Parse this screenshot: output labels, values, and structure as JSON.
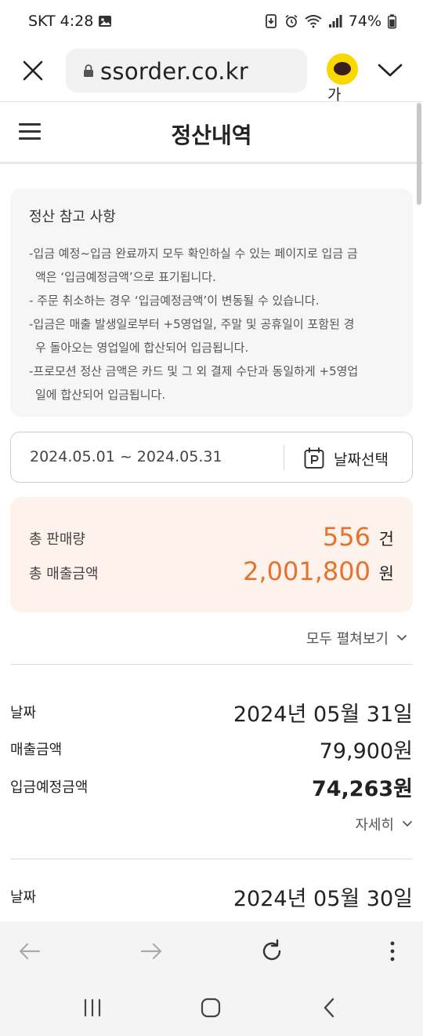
{
  "status_bar": {
    "carrier": "SKT",
    "time": "4:28",
    "battery": "74%"
  },
  "browser": {
    "url": "ssorder.co.kr",
    "text_size_label": "가가"
  },
  "header": {
    "title": "정산내역"
  },
  "notice": {
    "title": "정산 참고 사항",
    "lines": [
      "-입금 예정~입금 완료까지 모두 확인하실 수 있는 페이지로 입금 금",
      "액은 ‘입금예정금액’으로 표기됩니다.",
      "- 주문 취소하는 경우 ‘입금예정금액’이 변동될 수 있습니다.",
      "-입금은 매출 발생일로부터 +5영업일, 주말 및 공휴일이 포함된 경",
      "우 돌아오는 영업일에 합산되어 입금됩니다.",
      "-프로모션 정산 금액은 카드 및 그 외 결제 수단과 동일하게 +5영업",
      "일에 합산되어 입금됩니다."
    ]
  },
  "date_filter": {
    "range": "2024.05.01 ~ 2024.05.31",
    "picker_label": "날짜선택"
  },
  "summary": {
    "total_count_label": "총 판매량",
    "total_count_value": "556",
    "total_count_unit": "건",
    "total_sales_label": "총 매출금액",
    "total_sales_value": "2,001,800",
    "total_sales_unit": "원"
  },
  "expand_all_label": "모두 펼쳐보기",
  "records": [
    {
      "date_label": "날짜",
      "date_value": "2024년 05월 31일",
      "sales_label": "매출금액",
      "sales_value": "79,900원",
      "deposit_label": "입금예정금액",
      "deposit_value": "74,263원",
      "detail_label": "자세히"
    },
    {
      "date_label": "날짜",
      "date_value": "2024년 05월 30일"
    }
  ],
  "colors": {
    "accent": "#e5732d",
    "summary_bg": "#fdf2ec",
    "kakao_yellow": "#f9d800"
  }
}
